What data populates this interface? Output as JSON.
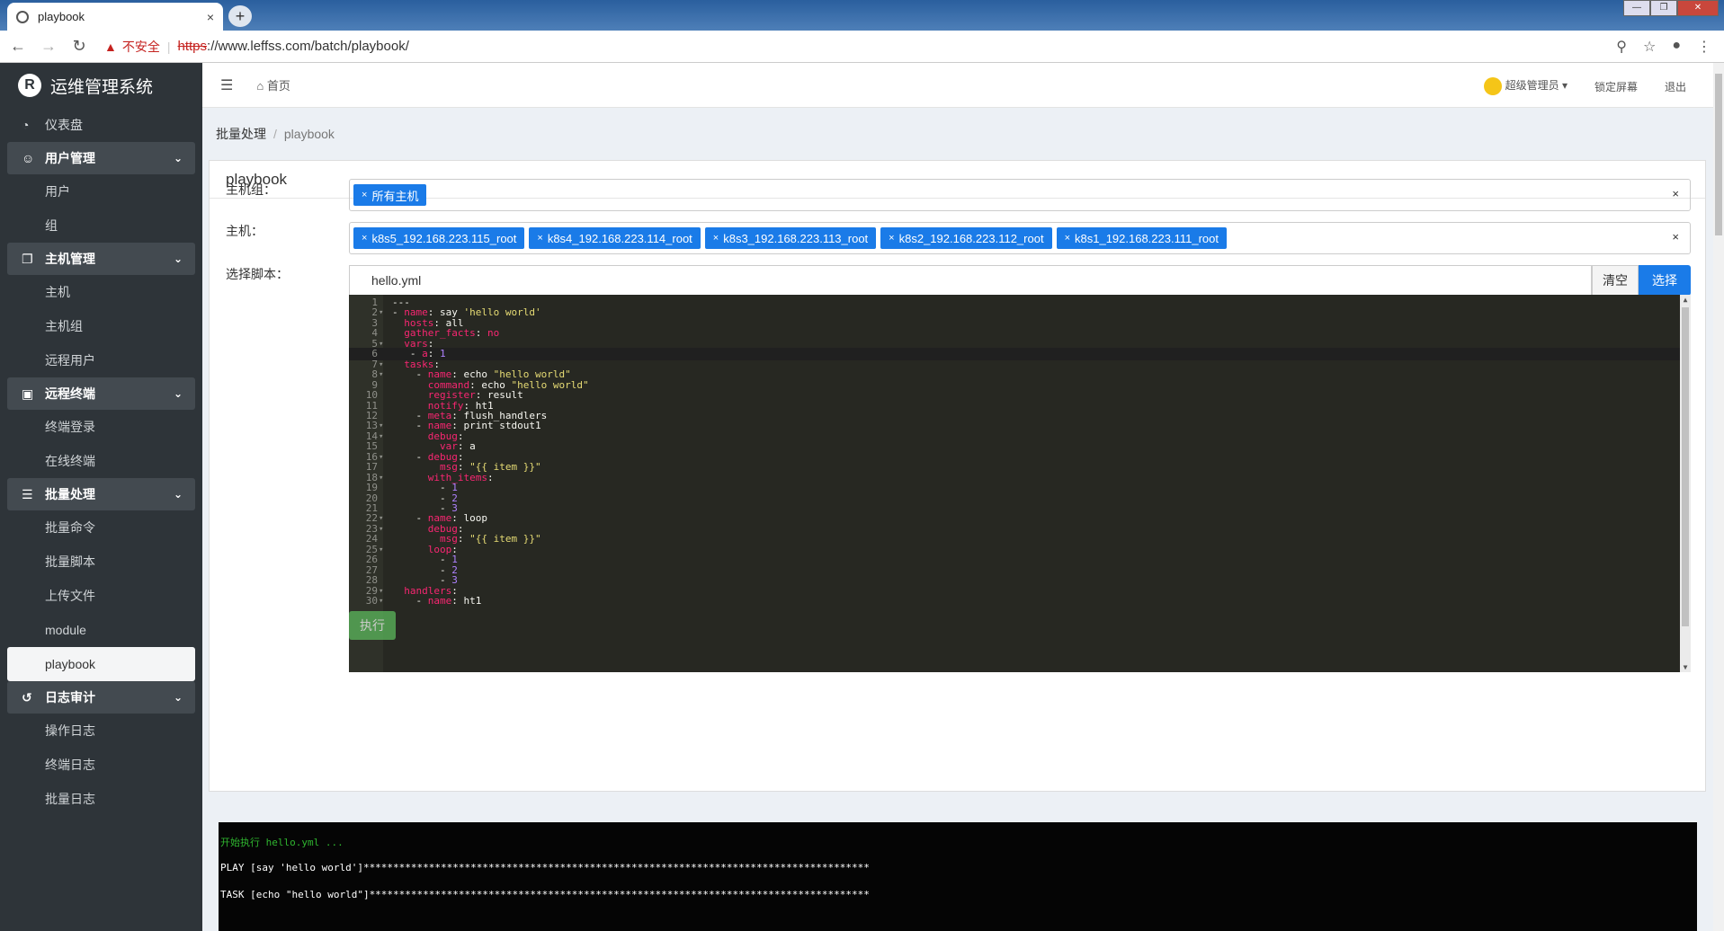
{
  "browser": {
    "tab_title": "playbook",
    "tab_close": "×",
    "new_tab": "+",
    "security_label": "不安全",
    "url_protocol": "https",
    "url_rest": "://www.leffss.com/batch/playbook/"
  },
  "sidebar": {
    "brand": "运维管理系统",
    "items": [
      {
        "type": "item",
        "label": "仪表盘",
        "icon": "dashboard-icon"
      },
      {
        "type": "group",
        "label": "用户管理",
        "icon": "user-icon"
      },
      {
        "type": "sub",
        "label": "用户"
      },
      {
        "type": "sub",
        "label": "组"
      },
      {
        "type": "group",
        "label": "主机管理",
        "icon": "copy-icon"
      },
      {
        "type": "sub",
        "label": "主机"
      },
      {
        "type": "sub",
        "label": "主机组"
      },
      {
        "type": "sub",
        "label": "远程用户"
      },
      {
        "type": "group",
        "label": "远程终端",
        "icon": "terminal-icon"
      },
      {
        "type": "sub",
        "label": "终端登录"
      },
      {
        "type": "sub",
        "label": "在线终端"
      },
      {
        "type": "group",
        "label": "批量处理",
        "icon": "list-icon"
      },
      {
        "type": "sub",
        "label": "批量命令"
      },
      {
        "type": "sub",
        "label": "批量脚本"
      },
      {
        "type": "sub",
        "label": "上传文件"
      },
      {
        "type": "sub",
        "label": "module"
      },
      {
        "type": "sub",
        "label": "playbook",
        "active": true
      },
      {
        "type": "group",
        "label": "日志审计",
        "icon": "history-icon"
      },
      {
        "type": "sub",
        "label": "操作日志"
      },
      {
        "type": "sub",
        "label": "终端日志"
      },
      {
        "type": "sub",
        "label": "批量日志"
      }
    ]
  },
  "topbar": {
    "home": "首页",
    "user": "超级管理员",
    "lock": "锁定屏幕",
    "logout": "退出"
  },
  "breadcrumb": {
    "parent": "批量处理",
    "current": "playbook"
  },
  "panel": {
    "title": "playbook",
    "hostgroup_label": "主机组：",
    "hostgroup_chips": [
      "所有主机"
    ],
    "host_label": "主机：",
    "host_chips": [
      "k8s5_192.168.223.115_root",
      "k8s4_192.168.223.114_root",
      "k8s3_192.168.223.113_root",
      "k8s2_192.168.223.112_root",
      "k8s1_192.168.223.111_root"
    ],
    "clear_x": "×",
    "chip_x": "×",
    "script_label": "选择脚本：",
    "script_value": "hello.yml",
    "clear_button": "清空",
    "select_button": "选择",
    "exec_button": "执行"
  },
  "editor": {
    "active_line": 6,
    "lines": [
      [
        [
          "---",
          "w"
        ]
      ],
      [
        [
          "- ",
          "w"
        ],
        [
          "name",
          "k"
        ],
        [
          ": say ",
          "w"
        ],
        [
          "'hello world'",
          "s"
        ]
      ],
      [
        [
          "  ",
          "w"
        ],
        [
          "hosts",
          "k"
        ],
        [
          ": all",
          "w"
        ]
      ],
      [
        [
          "  ",
          "w"
        ],
        [
          "gather_facts",
          "k"
        ],
        [
          ": ",
          "w"
        ],
        [
          "no",
          "k"
        ]
      ],
      [
        [
          "  ",
          "w"
        ],
        [
          "vars",
          "k"
        ],
        [
          ":",
          "w"
        ]
      ],
      [
        [
          "   - ",
          "w"
        ],
        [
          "a",
          "k"
        ],
        [
          ": ",
          "w"
        ],
        [
          "1",
          "n"
        ]
      ],
      [
        [
          "  ",
          "w"
        ],
        [
          "tasks",
          "k"
        ],
        [
          ":",
          "w"
        ]
      ],
      [
        [
          "    - ",
          "w"
        ],
        [
          "name",
          "k"
        ],
        [
          ": echo ",
          "w"
        ],
        [
          "\"hello world\"",
          "s"
        ]
      ],
      [
        [
          "      ",
          "w"
        ],
        [
          "command",
          "k"
        ],
        [
          ": echo ",
          "w"
        ],
        [
          "\"hello world\"",
          "s"
        ]
      ],
      [
        [
          "      ",
          "w"
        ],
        [
          "register",
          "k"
        ],
        [
          ": result",
          "w"
        ]
      ],
      [
        [
          "      ",
          "w"
        ],
        [
          "notify",
          "k"
        ],
        [
          ": ht1",
          "w"
        ]
      ],
      [
        [
          "    - ",
          "w"
        ],
        [
          "meta",
          "k"
        ],
        [
          ": flush_handlers",
          "w"
        ]
      ],
      [
        [
          "    - ",
          "w"
        ],
        [
          "name",
          "k"
        ],
        [
          ": print stdout1",
          "w"
        ]
      ],
      [
        [
          "      ",
          "w"
        ],
        [
          "debug",
          "k"
        ],
        [
          ":",
          "w"
        ]
      ],
      [
        [
          "        ",
          "w"
        ],
        [
          "var",
          "k"
        ],
        [
          ": a",
          "w"
        ]
      ],
      [
        [
          "    - ",
          "w"
        ],
        [
          "debug",
          "k"
        ],
        [
          ":",
          "w"
        ]
      ],
      [
        [
          "        ",
          "w"
        ],
        [
          "msg",
          "k"
        ],
        [
          ": ",
          "w"
        ],
        [
          "\"{{ item }}\"",
          "s"
        ]
      ],
      [
        [
          "      ",
          "w"
        ],
        [
          "with_items",
          "k"
        ],
        [
          ":",
          "w"
        ]
      ],
      [
        [
          "        - ",
          "w"
        ],
        [
          "1",
          "n"
        ]
      ],
      [
        [
          "        - ",
          "w"
        ],
        [
          "2",
          "n"
        ]
      ],
      [
        [
          "        - ",
          "w"
        ],
        [
          "3",
          "n"
        ]
      ],
      [
        [
          "    - ",
          "w"
        ],
        [
          "name",
          "k"
        ],
        [
          ": loop",
          "w"
        ]
      ],
      [
        [
          "      ",
          "w"
        ],
        [
          "debug",
          "k"
        ],
        [
          ":",
          "w"
        ]
      ],
      [
        [
          "        ",
          "w"
        ],
        [
          "msg",
          "k"
        ],
        [
          ": ",
          "w"
        ],
        [
          "\"{{ item }}\"",
          "s"
        ]
      ],
      [
        [
          "      ",
          "w"
        ],
        [
          "loop",
          "k"
        ],
        [
          ":",
          "w"
        ]
      ],
      [
        [
          "        - ",
          "w"
        ],
        [
          "1",
          "n"
        ]
      ],
      [
        [
          "        - ",
          "w"
        ],
        [
          "2",
          "n"
        ]
      ],
      [
        [
          "        - ",
          "w"
        ],
        [
          "3",
          "n"
        ]
      ],
      [
        [
          "  ",
          "w"
        ],
        [
          "handlers",
          "k"
        ],
        [
          ":",
          "w"
        ]
      ],
      [
        [
          "    - ",
          "w"
        ],
        [
          "name",
          "k"
        ],
        [
          ": ht1",
          "w"
        ]
      ]
    ],
    "fold_lines": [
      2,
      5,
      7,
      8,
      13,
      14,
      16,
      18,
      22,
      23,
      25,
      29,
      30
    ],
    "colors": {
      "k": "#f92672",
      "s": "#e6db74",
      "n": "#ae81ff",
      "w": "#f8f8f2"
    }
  },
  "terminal": {
    "lines": [
      {
        "text": "开始执行 hello.yml ...",
        "color": "green"
      },
      {
        "text": "PLAY [say 'hello world']*************************************************************************************",
        "color": "white"
      },
      {
        "text": "TASK [echo \"hello world\"]************************************************************************************",
        "color": "white"
      }
    ]
  }
}
